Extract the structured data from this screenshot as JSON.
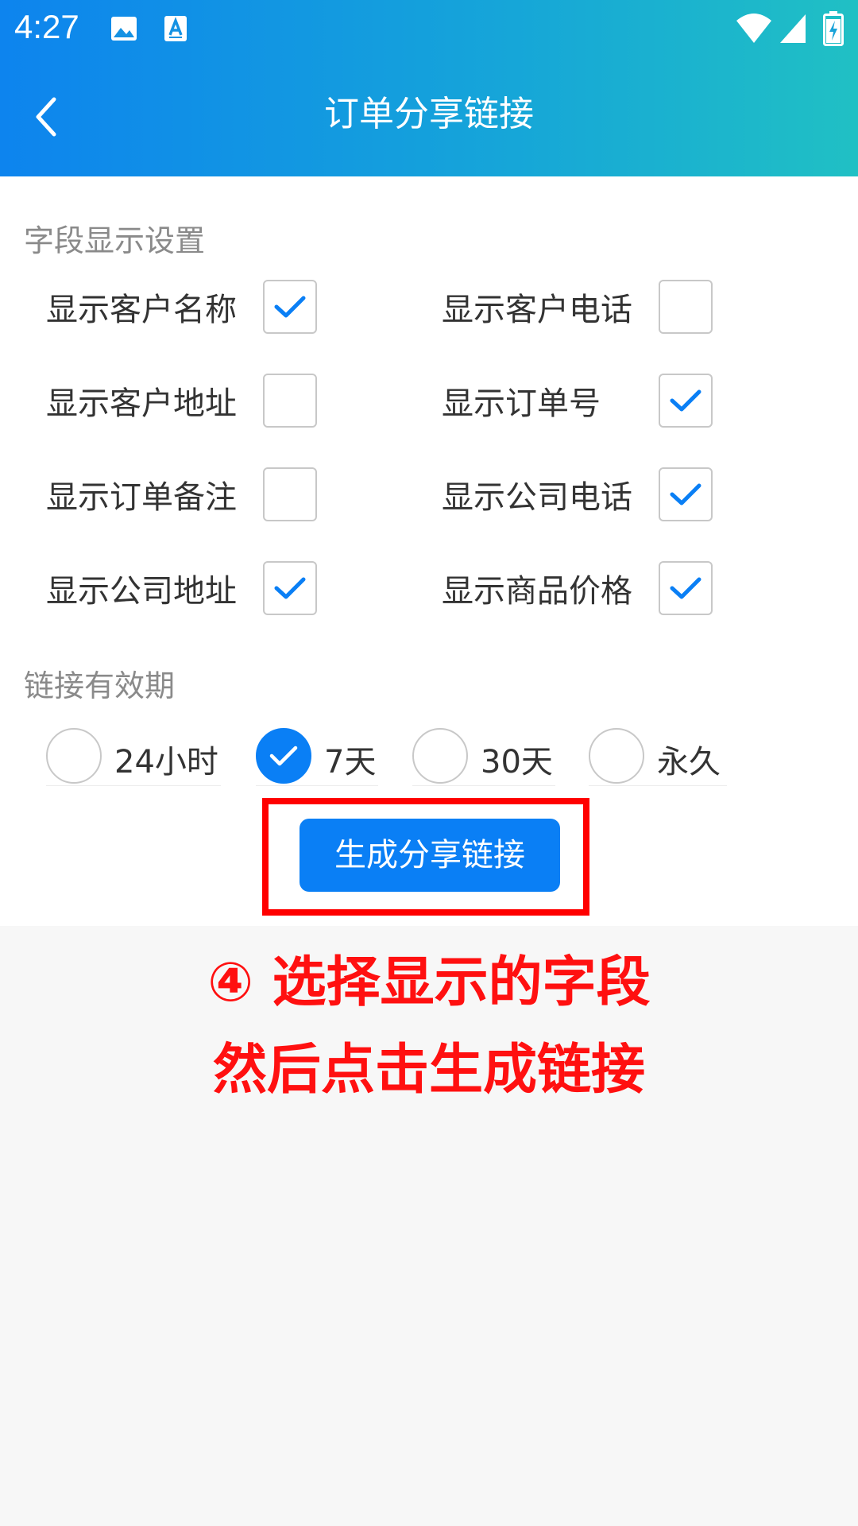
{
  "status_bar": {
    "time": "4:27",
    "left_icons": [
      "image-icon",
      "text-recognition-icon"
    ],
    "right_icons": [
      "wifi-icon",
      "cellular-signal-icon",
      "battery-charging-icon"
    ]
  },
  "header": {
    "title": "订单分享链接",
    "back_icon": "chevron-left-icon",
    "gradient_colors": [
      "#0d84ee",
      "#20c0c4"
    ]
  },
  "field_settings": {
    "label": "字段显示设置",
    "fields": [
      {
        "label": "显示客户名称",
        "checked": true
      },
      {
        "label": "显示客户电话",
        "checked": false
      },
      {
        "label": "显示客户地址",
        "checked": false
      },
      {
        "label": "显示订单号",
        "checked": true
      },
      {
        "label": "显示订单备注",
        "checked": false
      },
      {
        "label": "显示公司电话",
        "checked": true
      },
      {
        "label": "显示公司地址",
        "checked": true
      },
      {
        "label": "显示商品价格",
        "checked": true
      }
    ]
  },
  "validity": {
    "label": "链接有效期",
    "options": [
      {
        "label": "24小时",
        "selected": false
      },
      {
        "label": "7天",
        "selected": true
      },
      {
        "label": "30天",
        "selected": false
      },
      {
        "label": "永久",
        "selected": false
      }
    ]
  },
  "generate_button": {
    "label": "生成分享链接"
  },
  "annotation": {
    "line1": "④ 选择显示的字段",
    "line2": "然后点击生成链接",
    "color": "#ff0000"
  },
  "colors": {
    "accent": "#0a7ff5",
    "highlight": "#ff0000"
  }
}
